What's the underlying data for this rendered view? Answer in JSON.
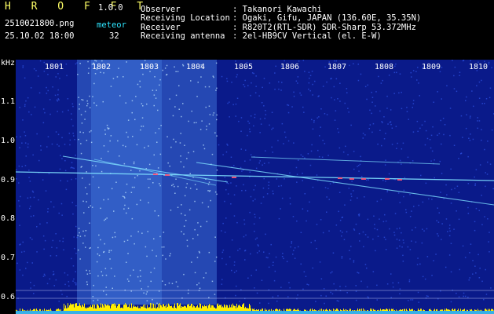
{
  "header": {
    "app_name": "H R O F F T",
    "version": "1.0.0",
    "filename": "2510021800.png",
    "datetime": "25.10.02 18:00",
    "meteor_label": "meteor",
    "meteor_count": "32",
    "fields": [
      {
        "label": "Observer",
        "value": ": Takanori Kawachi"
      },
      {
        "label": "Receiving Location",
        "value": ": Ogaki, Gifu, JAPAN (136.60E, 35.35N)"
      },
      {
        "label": "Receiver",
        "value": ": R820T2(RTL-SDR) SDR-Sharp 53.372MHz"
      },
      {
        "label": "Receiving antenna",
        "value": ": 2el-HB9CV Vertical (el. E-W)"
      }
    ]
  },
  "spectrogram": {
    "unit_label": "kHz",
    "y_ticks": [
      "1.1",
      "1.0",
      "0.9",
      "0.8",
      "0.7",
      "0.6"
    ],
    "x_ticks": [
      "1801",
      "1802",
      "1803",
      "1804",
      "1805",
      "1806",
      "1807",
      "1808",
      "1809",
      "1810"
    ],
    "colors": {
      "background": "#0a1a8a",
      "noise_dot": "#3a64ff",
      "band": "#5aa0ff",
      "signal_line": "#7fe0ff",
      "meteor": "#ff5577",
      "power_bar": "#ffee00",
      "baseline": "#22aaff"
    }
  }
}
